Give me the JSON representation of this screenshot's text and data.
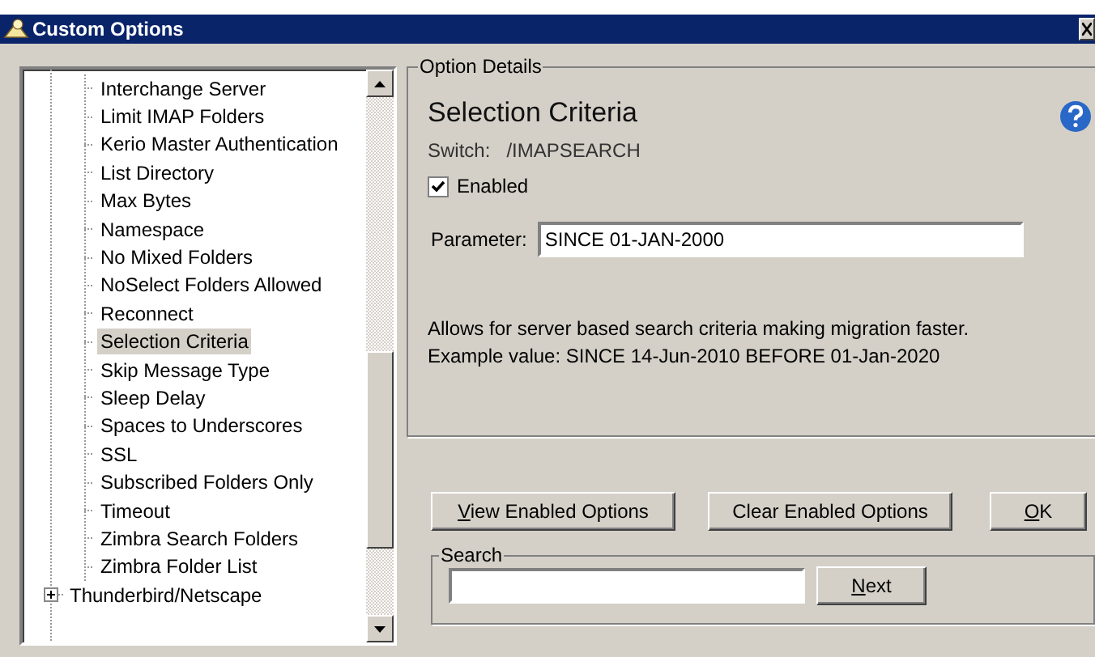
{
  "window": {
    "title": "Custom Options"
  },
  "tree": {
    "items": [
      {
        "children": [
          {
            "label": "Interchange Server",
            "selected": false
          },
          {
            "label": "Limit IMAP Folders",
            "selected": false
          },
          {
            "label": "Kerio Master Authentication",
            "selected": false
          },
          {
            "label": "List Directory",
            "selected": false
          },
          {
            "label": "Max Bytes",
            "selected": false
          },
          {
            "label": "Namespace",
            "selected": false
          },
          {
            "label": "No Mixed Folders",
            "selected": false
          },
          {
            "label": "NoSelect Folders Allowed",
            "selected": false
          },
          {
            "label": "Reconnect",
            "selected": false
          },
          {
            "label": "Selection Criteria",
            "selected": true
          },
          {
            "label": "Skip Message Type",
            "selected": false
          },
          {
            "label": "Sleep Delay",
            "selected": false
          },
          {
            "label": "Spaces to Underscores",
            "selected": false
          },
          {
            "label": "SSL",
            "selected": false
          },
          {
            "label": "Subscribed Folders Only",
            "selected": false
          },
          {
            "label": "Timeout",
            "selected": false
          },
          {
            "label": "Zimbra Search Folders",
            "selected": false
          },
          {
            "label": "Zimbra Folder List",
            "selected": false
          }
        ]
      },
      {
        "label": "Thunderbird/Netscape",
        "expanded": false,
        "selected": false
      }
    ]
  },
  "details": {
    "group_label": "Option Details",
    "heading": "Selection Criteria",
    "switch_label": "Switch:",
    "switch_value": "/IMAPSEARCH",
    "enabled": {
      "label": "Enabled",
      "checked": true
    },
    "parameter": {
      "label": "Parameter:",
      "value": "SINCE 01-JAN-2000"
    },
    "description": [
      "Allows for server based search criteria making migration faster.",
      "Example value: SINCE 14-Jun-2010 BEFORE 01-Jan-2020"
    ]
  },
  "buttons": [
    {
      "mnemonic": "V",
      "rest": "iew Enabled Options"
    },
    {
      "rest": "Clear Enabled Options"
    },
    {
      "mnemonic": "O",
      "rest": "K"
    }
  ],
  "search": {
    "group_label": "Search",
    "button": {
      "mnemonic": "N",
      "rest": "ext"
    }
  }
}
